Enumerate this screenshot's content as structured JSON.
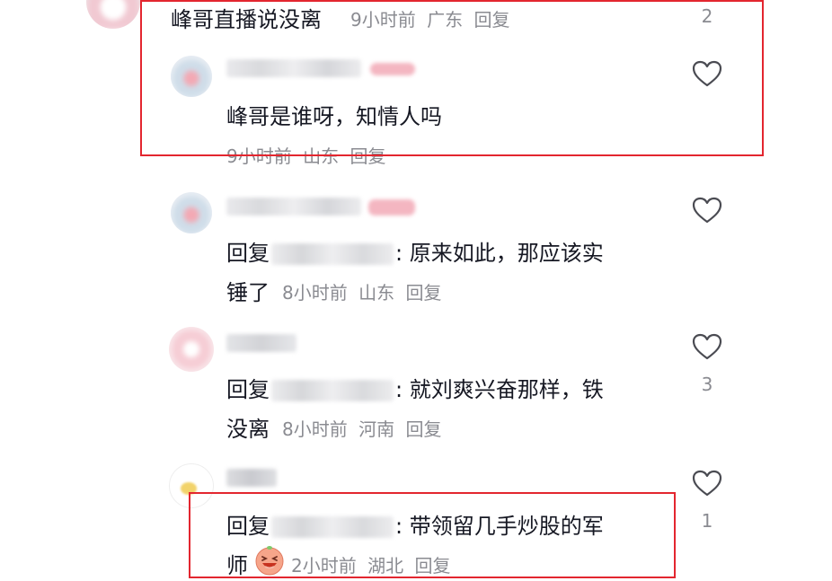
{
  "top_comment": {
    "text": "峰哥直播说没离",
    "time": "9小时前",
    "location": "广东",
    "reply": "回复",
    "likes": "2"
  },
  "replies": [
    {
      "text": "峰哥是谁呀，知情人吗",
      "time": "9小时前",
      "location": "山东",
      "reply": "回复",
      "likes": ""
    },
    {
      "reply_prefix": "回复",
      "text_line1": ": 原来如此，那应该实",
      "text_line2": "锤了",
      "time": "8小时前",
      "location": "山东",
      "reply": "回复",
      "likes": ""
    },
    {
      "reply_prefix": "回复",
      "text_line1": ": 就刘爽兴奋那样，铁",
      "text_line2": "没离",
      "time": "8小时前",
      "location": "河南",
      "reply": "回复",
      "likes": "3"
    },
    {
      "reply_prefix": "回复",
      "text_line1": ": 带领留几手炒股的军",
      "text_line2": "师",
      "time": "2小时前",
      "location": "湖北",
      "reply": "回复",
      "likes": "1"
    }
  ],
  "colors": {
    "text": "#161823",
    "meta": "#8a8b91",
    "highlight_box": "#e3262f"
  },
  "icons": [
    "heart-outline-icon",
    "laughing-emoji-icon"
  ]
}
